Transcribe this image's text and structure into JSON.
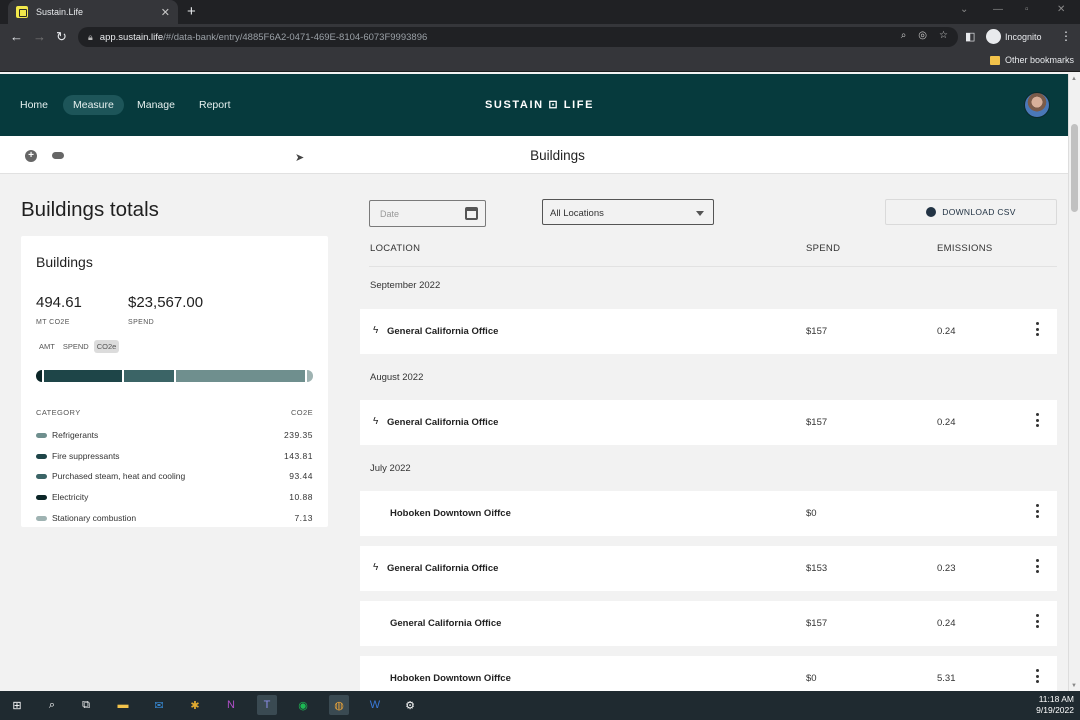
{
  "browser": {
    "tab_title": "Sustain.Life",
    "tab_close": "✕",
    "newtab": "+",
    "url_host": "app.sustain.life",
    "url_path": "/#/data-bank/entry/4885F6A2-0471-469E-8104-6073F9993896",
    "incognito_label": "Incognito",
    "other_bookmarks": "Other bookmarks"
  },
  "header": {
    "nav": [
      "Home",
      "Measure",
      "Manage",
      "Report"
    ],
    "active_nav": "Measure",
    "brand": "SUSTAIN ⊡ LIFE"
  },
  "subheader": {
    "title": "Buildings"
  },
  "left": {
    "title": "Buildings totals",
    "card_title": "Buildings",
    "emissions_value": "494.61",
    "emissions_label": "MT CO2E",
    "spend_value": "$23,567.00",
    "spend_label": "SPEND",
    "segments": [
      "AMT",
      "SPEND",
      "CO2e"
    ],
    "category_header": "CATEGORY",
    "co2e_header": "CO2E",
    "categories": [
      {
        "name": "Refrigerants",
        "value": "239.35",
        "color": "#6f8f8e"
      },
      {
        "name": "Fire suppressants",
        "value": "143.81",
        "color": "#1e4548"
      },
      {
        "name": "Purchased steam, heat and cooling",
        "value": "93.44",
        "color": "#3b6466"
      },
      {
        "name": "Electricity",
        "value": "10.88",
        "color": "#0b2527"
      },
      {
        "name": "Stationary combustion",
        "value": "7.13",
        "color": "#9fb3b2"
      }
    ]
  },
  "filters": {
    "date_placeholder": "Date",
    "location_value": "All Locations",
    "download_label": "DOWNLOAD CSV"
  },
  "table": {
    "headers": {
      "location": "LOCATION",
      "spend": "SPEND",
      "emissions": "EMISSIONS"
    },
    "groups": [
      {
        "label": "September 2022",
        "rows": [
          {
            "location": "General California Office",
            "spend": "$157",
            "emissions": "0.24",
            "bolt": true
          }
        ]
      },
      {
        "label": "August 2022",
        "rows": [
          {
            "location": "General California Office",
            "spend": "$157",
            "emissions": "0.24",
            "bolt": true
          }
        ]
      },
      {
        "label": "July 2022",
        "rows": [
          {
            "location": "Hoboken Downtown Oiffce",
            "spend": "$0",
            "emissions": "",
            "bolt": false
          },
          {
            "location": "General California Office",
            "spend": "$153",
            "emissions": "0.23",
            "bolt": true
          },
          {
            "location": "General California Office",
            "spend": "$157",
            "emissions": "0.24",
            "bolt": false
          },
          {
            "location": "Hoboken Downtown Oiffce",
            "spend": "$0",
            "emissions": "5.31",
            "bolt": false
          }
        ]
      }
    ]
  },
  "taskbar": {
    "time": "11:18 AM",
    "date": "9/19/2022"
  }
}
